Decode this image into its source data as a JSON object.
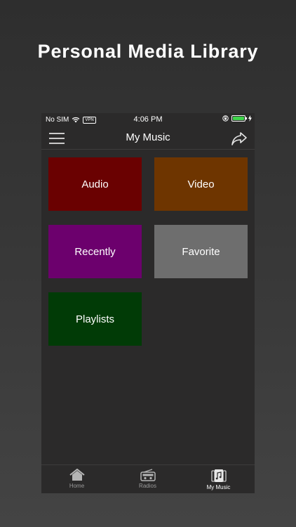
{
  "promo": {
    "headline": "Personal Media Library"
  },
  "status_bar": {
    "carrier": "No SIM",
    "vpn": "VPN",
    "time": "4:06 PM"
  },
  "nav": {
    "title": "My Music",
    "menu_icon": "hamburger-menu-icon",
    "share_icon": "share-icon"
  },
  "tiles": [
    {
      "label": "Audio",
      "color": "#6a0101"
    },
    {
      "label": "Video",
      "color": "#6e3500"
    },
    {
      "label": "Recently",
      "color": "#6c006d"
    },
    {
      "label": "Favorite",
      "color": "#6e6e6e"
    },
    {
      "label": "Playlists",
      "color": "#013b06"
    }
  ],
  "tab_bar": {
    "items": [
      {
        "label": "Home",
        "icon": "home-icon",
        "active": false
      },
      {
        "label": "Radios",
        "icon": "radio-icon",
        "active": false
      },
      {
        "label": "My Music",
        "icon": "music-library-icon",
        "active": true
      }
    ]
  }
}
